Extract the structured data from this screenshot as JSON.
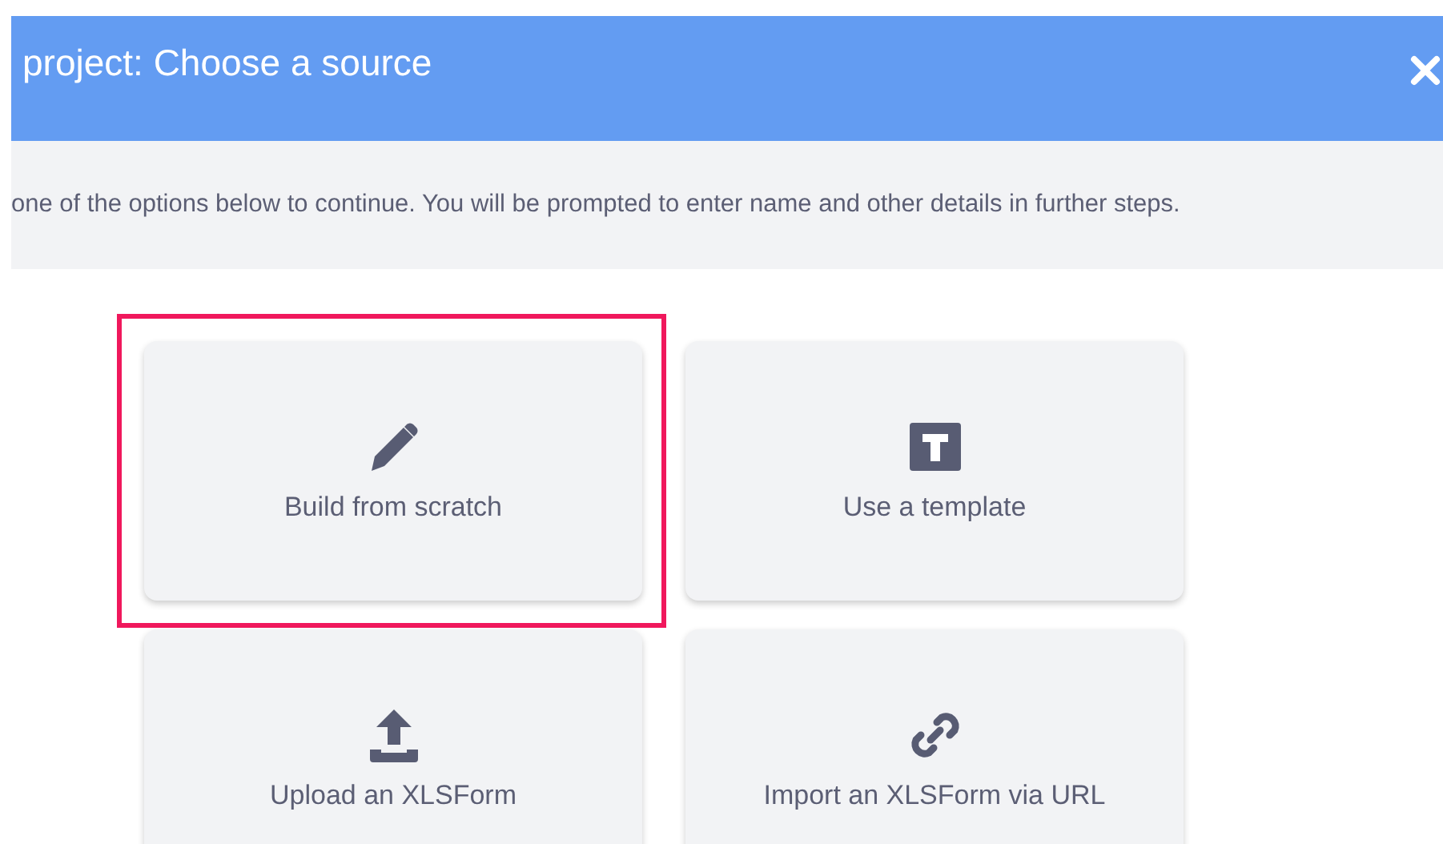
{
  "header": {
    "title": "project: Choose a source"
  },
  "instructions": "one of the options below to continue. You will be prompted to enter name and other details in further steps.",
  "options": [
    {
      "kind": "pencil",
      "label": "Build from scratch",
      "selected": true
    },
    {
      "kind": "template",
      "label": "Use a template",
      "selected": false
    },
    {
      "kind": "upload",
      "label": "Upload an XLSForm",
      "selected": false
    },
    {
      "kind": "link",
      "label": "Import an XLSForm via URL",
      "selected": false
    }
  ]
}
